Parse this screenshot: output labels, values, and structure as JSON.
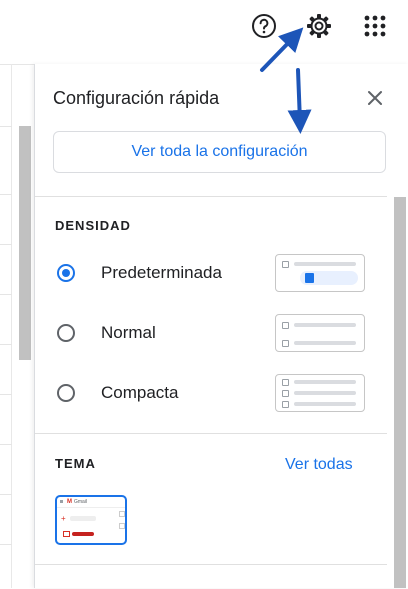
{
  "header": {
    "help_icon": "help-circle-icon",
    "settings_icon": "gear-icon",
    "apps_icon": "apps-grid-icon"
  },
  "panel": {
    "title": "Configuración rápida",
    "close_icon": "close-icon",
    "see_all_settings": "Ver toda la configuración"
  },
  "density": {
    "title": "DENSIDAD",
    "options": [
      {
        "label": "Predeterminada",
        "selected": true
      },
      {
        "label": "Normal",
        "selected": false
      },
      {
        "label": "Compacta",
        "selected": false
      }
    ]
  },
  "theme": {
    "title": "TEMA",
    "see_all": "Ver todas",
    "thumbnail_brand": "Gmail"
  },
  "colors": {
    "accent": "#1a73e8",
    "annotation_arrow": "#1d55b8",
    "divider": "#e0e0e0"
  }
}
